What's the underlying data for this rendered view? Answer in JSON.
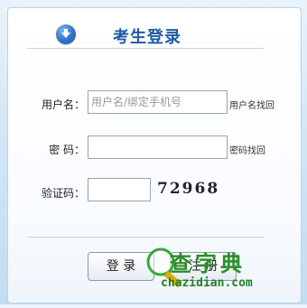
{
  "header": {
    "title": "考生登录",
    "icon": "down-arrow-icon"
  },
  "form": {
    "username_label": "用户名：",
    "username_placeholder": "用户名/绑定手机号",
    "username_recover": "用户名找回",
    "password_label": "密 码：",
    "password_recover": "密码找回",
    "captcha_label": "验证码：",
    "captcha_text": "72968"
  },
  "buttons": {
    "login": "登 录",
    "register": "注 册"
  },
  "watermark": {
    "text": "查字典",
    "url": "chazidian.com"
  },
  "colors": {
    "accent": "#1f5aa6",
    "watermark": "#2a8d2a"
  }
}
